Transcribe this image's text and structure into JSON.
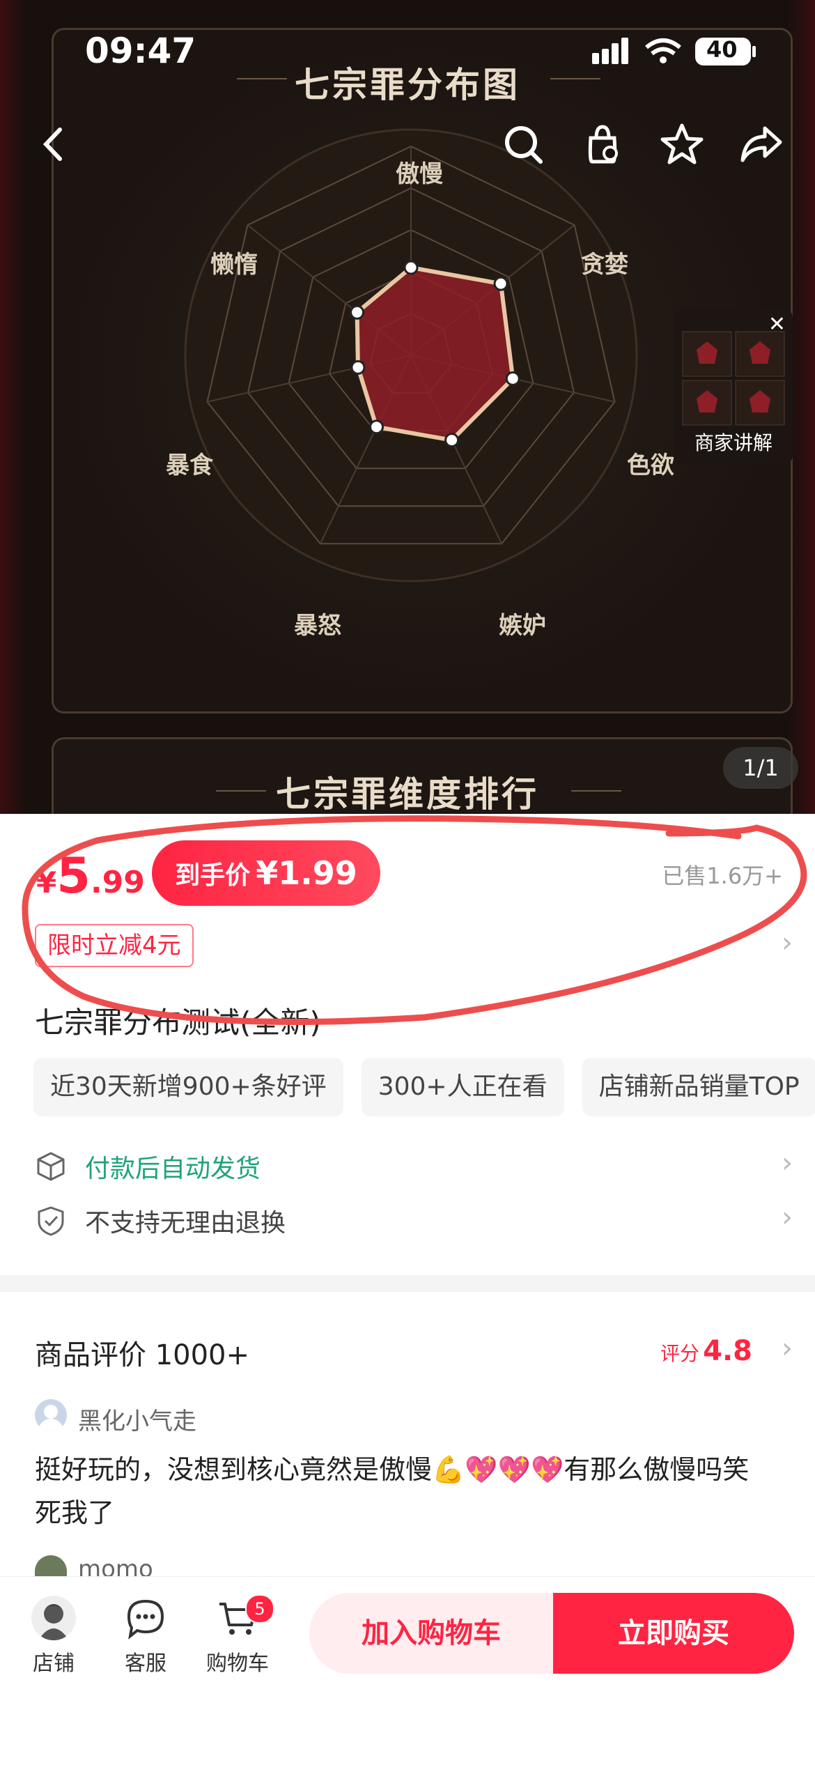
{
  "status_bar": {
    "time": "09:47",
    "battery": "40"
  },
  "hero": {
    "card_title": "七宗罪分布图",
    "card2_title": "七宗罪维度排行",
    "merchant_explain": "商家讲解",
    "pager": "1/1",
    "radar": {
      "axes": [
        "傲慢",
        "贪婪",
        "色欲",
        "嫉妒",
        "暴怒",
        "暴食",
        "懒惰"
      ],
      "values": [
        0.42,
        0.55,
        0.5,
        0.45,
        0.38,
        0.26,
        0.33
      ],
      "fill_color": "#8f1f27",
      "line_color": "#e8c7a3"
    }
  },
  "price": {
    "currency": "¥",
    "integer": "5",
    "decimal": ".99",
    "deal_label": "到手价",
    "deal_amount": "¥1.99",
    "sold": "已售1.6万+",
    "promo_tag": "限时立减4元"
  },
  "product": {
    "title": "七宗罪分布测试(全新)",
    "tags": [
      "近30天新增900+条好评",
      "300+人正在看",
      "店铺新品销量TOP"
    ],
    "services": [
      {
        "text": "付款后自动发货",
        "color": "#1fa37a",
        "icon": "box-icon"
      },
      {
        "text": "不支持无理由退换",
        "color": "#444444",
        "icon": "shield-check-icon"
      }
    ]
  },
  "reviews": {
    "title": "商品评价 1000+",
    "score_label": "评分",
    "score": "4.8",
    "items": [
      {
        "user": "黑化小气走",
        "text": "挺好玩的，没想到核心竟然是傲慢💪💖💖💖有那么傲慢吗笑死我了"
      },
      {
        "user": "momo"
      }
    ]
  },
  "bottom_bar": {
    "store": "店铺",
    "service": "客服",
    "cart": "购物车",
    "cart_count": "5",
    "add_to_cart": "加入购物车",
    "buy_now": "立即购买"
  },
  "colors": {
    "brand_red": "#ff2442",
    "service_green": "#1fa37a"
  }
}
